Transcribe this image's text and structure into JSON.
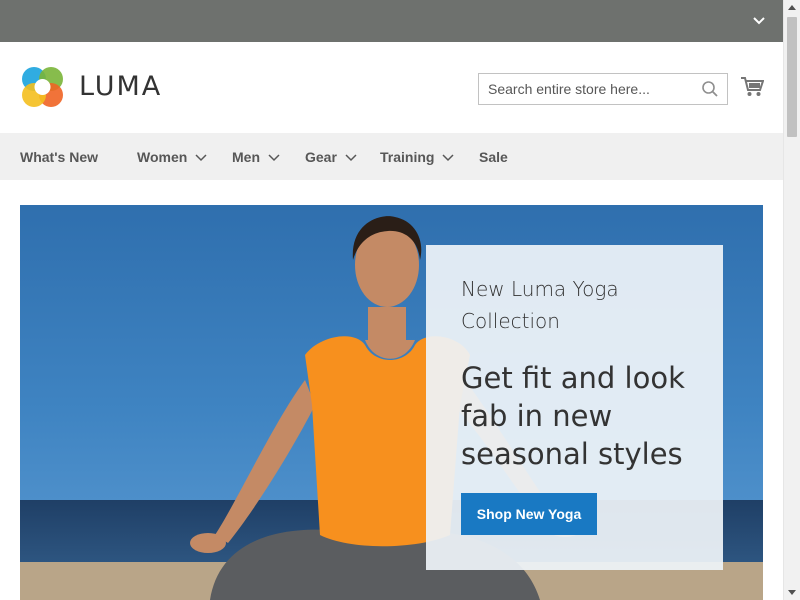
{
  "header": {
    "brand": "LUMA",
    "search": {
      "placeholder": "Search entire store here..."
    }
  },
  "nav": {
    "items": [
      {
        "label": "What's New",
        "has_dropdown": false
      },
      {
        "label": "Women",
        "has_dropdown": true
      },
      {
        "label": "Men",
        "has_dropdown": true
      },
      {
        "label": "Gear",
        "has_dropdown": true
      },
      {
        "label": "Training",
        "has_dropdown": true
      },
      {
        "label": "Sale",
        "has_dropdown": false
      }
    ]
  },
  "hero": {
    "subtitle": "New Luma Yoga Collection",
    "title": "Get fit and look fab in new seasonal styles",
    "cta": "Shop New Yoga"
  },
  "colors": {
    "top_bar": "#6e716e",
    "nav_bg": "#f0f0f0",
    "button": "#1979c3"
  },
  "icons": [
    "chevron-down-icon",
    "luma-logo-icon",
    "search-icon",
    "cart-icon"
  ]
}
